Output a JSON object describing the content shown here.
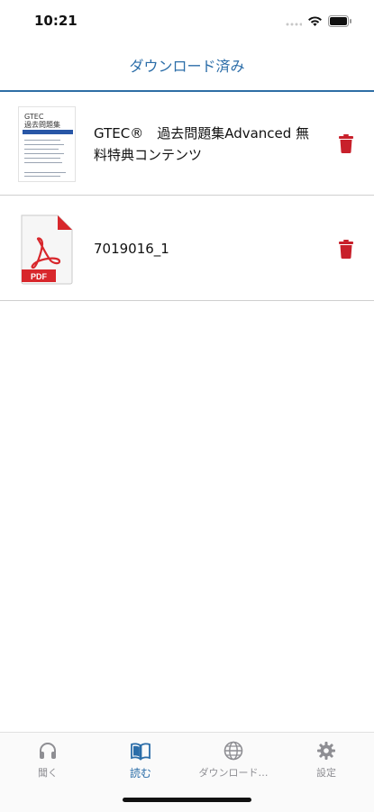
{
  "status_bar": {
    "time": "10:21"
  },
  "header": {
    "title": "ダウンロード済み"
  },
  "items": [
    {
      "title": "GTEC®　過去問題集Advanced 無料特典コンテンツ",
      "thumb_title": "GTEC\n過去問題集"
    },
    {
      "title": "7019016_1",
      "thumb_label": "PDF"
    }
  ],
  "tabs": [
    {
      "label": "聞く",
      "icon": "headphones-icon"
    },
    {
      "label": "読む",
      "icon": "book-icon",
      "active": true
    },
    {
      "label": "ダウンロード…",
      "icon": "globe-icon"
    },
    {
      "label": "設定",
      "icon": "gear-icon"
    }
  ],
  "colors": {
    "accent": "#2b6da8",
    "trash": "#c8202b",
    "pdf_red": "#d8272c"
  }
}
